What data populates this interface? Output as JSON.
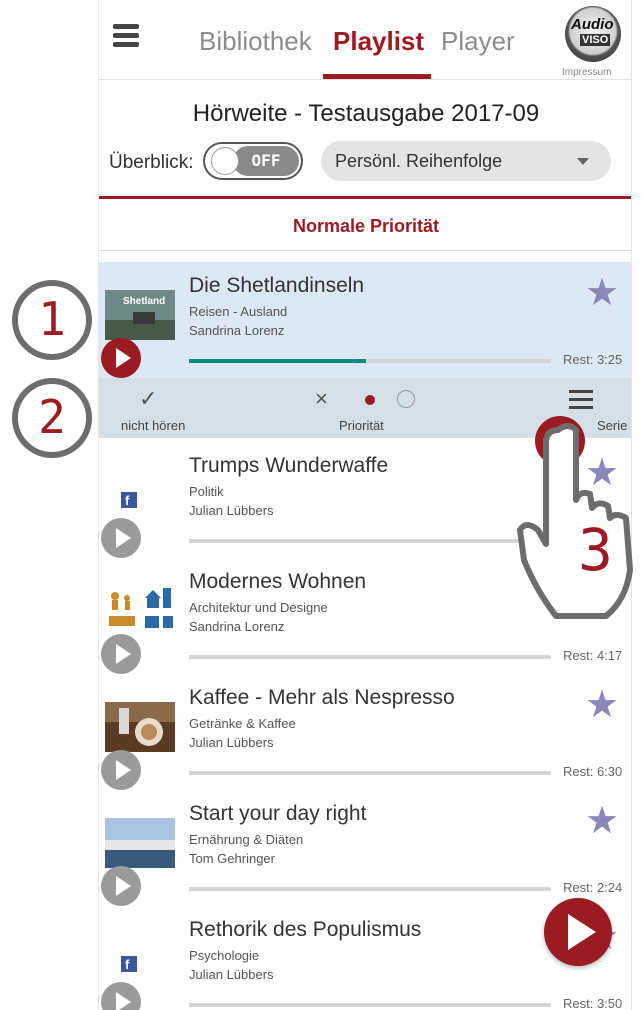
{
  "header": {
    "tabs": [
      "Bibliothek",
      "Playlist",
      "Player"
    ],
    "active_tab": "Playlist",
    "logo_line1": "Audio",
    "logo_line2": "VISO",
    "impressum": "Impressum"
  },
  "playlist": {
    "title": "Hörweite - Testausgabe 2017-09",
    "overview_label": "Überblick:",
    "toggle_state": "OFF",
    "sort_select": "Persönl. Reihenfolge",
    "section": "Normale Priorität"
  },
  "items": [
    {
      "title": "Die Shetlandinseln",
      "category": "Reisen - Ausland",
      "author": "Sandrina Lorenz",
      "rest": "Rest: 3:25",
      "progress": 0.49,
      "thumb_text": "Shetland"
    },
    {
      "title": "Trumps Wunderwaffe",
      "category": "Politik",
      "author": "Julian Lübbers",
      "rest": "",
      "progress": 0
    },
    {
      "title": "Modernes Wohnen",
      "category": "Architektur und Designe",
      "author": "Sandrina Lorenz",
      "rest": "Rest: 4:17",
      "progress": 0
    },
    {
      "title": "Kaffee - Mehr als Nespresso",
      "category": "Getränke & Kaffee",
      "author": "Julian Lübbers",
      "rest": "Rest: 6:30",
      "progress": 0
    },
    {
      "title": "Start your day right",
      "category": "Ernährung & Diäten",
      "author": "Tom Gehringer",
      "rest": "Rest: 2:24",
      "progress": 0
    },
    {
      "title": "Rethorik des Populismus",
      "category": "Psychologie",
      "author": "Julian Lübbers",
      "rest": "Rest: 3:50",
      "progress": 0
    }
  ],
  "actions": {
    "check_label": "nicht hören",
    "priority_label": "Priorität",
    "menu_label": "Serie"
  },
  "annotations": [
    "1",
    "2",
    "3"
  ],
  "colors": {
    "accent": "#9b1b22",
    "active_row": "#dce8f4",
    "progress": "#0a8a86",
    "star": "#8a88b8"
  }
}
